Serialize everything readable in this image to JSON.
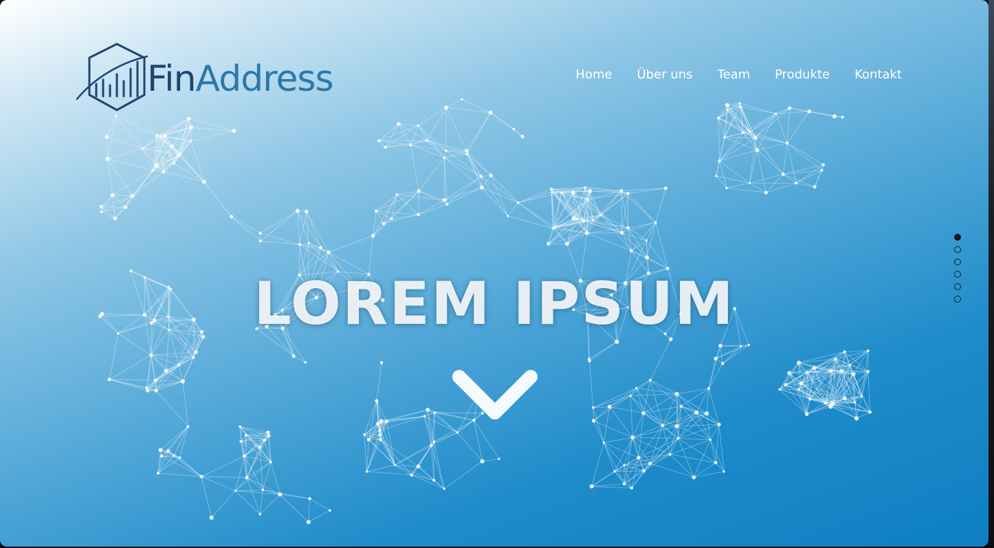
{
  "brand": {
    "name_part1": "Fin",
    "name_part2": "Address",
    "logo_icon": "hexagon-chart-icon",
    "color_dark": "#1c4572",
    "color_light": "#2b78a8"
  },
  "nav": {
    "items": [
      {
        "label": "Home"
      },
      {
        "label": "Über uns"
      },
      {
        "label": "Team"
      },
      {
        "label": "Produkte"
      },
      {
        "label": "Kontakt"
      }
    ]
  },
  "hero": {
    "headline": "LOREM IPSUM",
    "scroll_icon": "chevron-down-icon",
    "background_icon": "network-mesh-icon",
    "gradient_colors": [
      "#ffffff",
      "#8fc7e6",
      "#0d7fc2"
    ]
  },
  "slider": {
    "count": 6,
    "active_index": 0
  }
}
